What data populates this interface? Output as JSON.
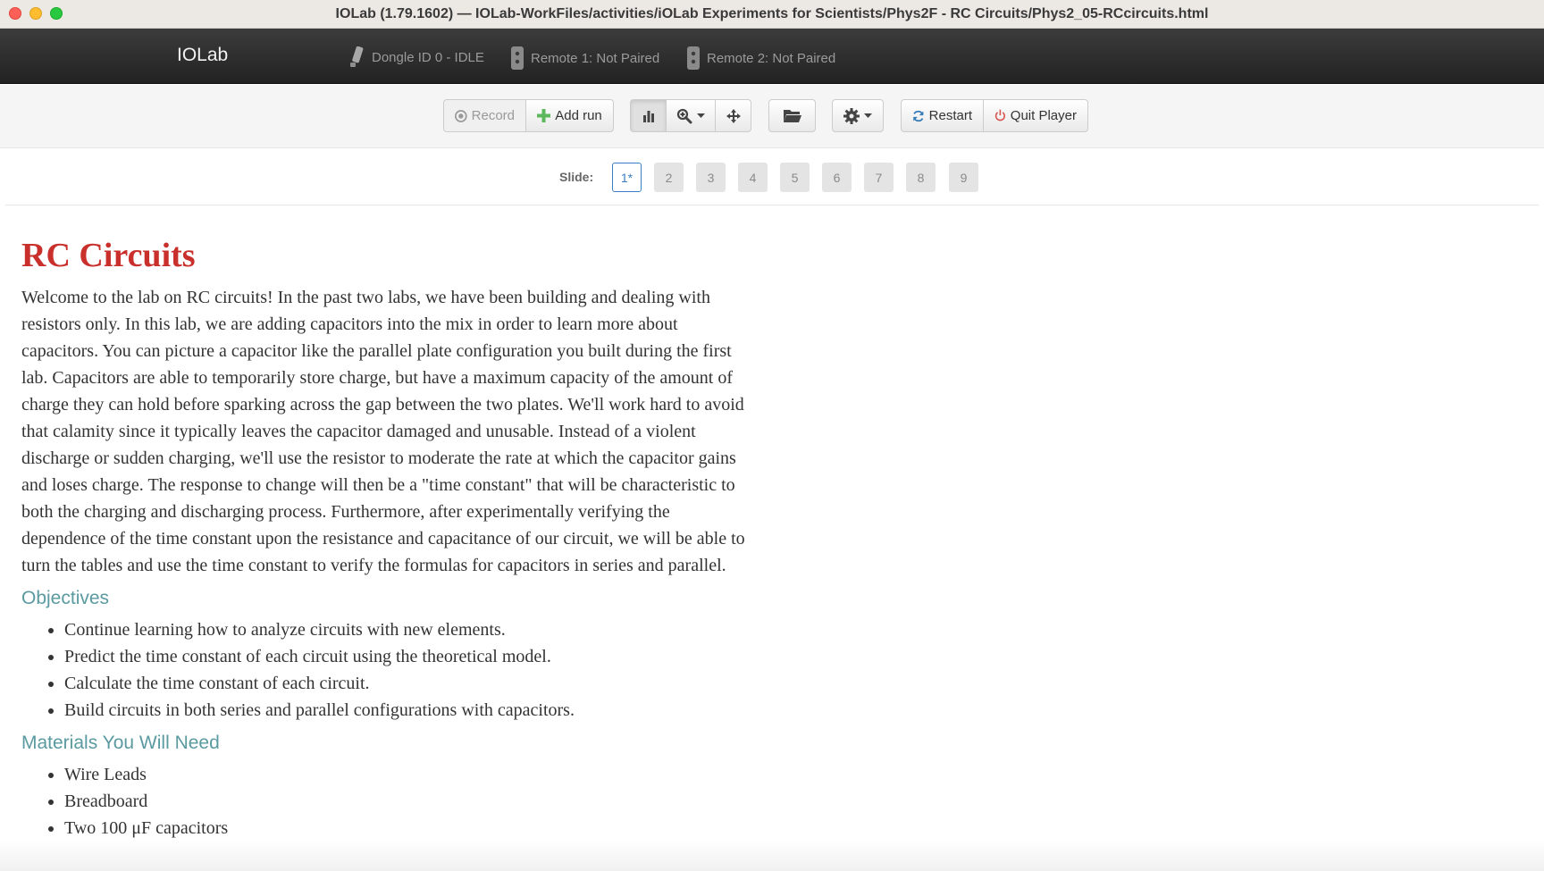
{
  "window": {
    "title": "IOLab (1.79.1602) — IOLab-WorkFiles/activities/iOLab Experiments for Scientists/Phys2F - RC Circuits/Phys2_05-RCcircuits.html"
  },
  "navbar": {
    "brand": "IOLab",
    "dongle": "Dongle ID 0 - IDLE",
    "remote1": "Remote 1: Not Paired",
    "remote2": "Remote 2: Not Paired"
  },
  "toolbar": {
    "record": "Record",
    "add_run": "Add run",
    "restart": "Restart",
    "quit": "Quit Player"
  },
  "slides": {
    "label": "Slide:",
    "items": [
      "1*",
      "2",
      "3",
      "4",
      "5",
      "6",
      "7",
      "8",
      "9"
    ]
  },
  "content": {
    "title": "RC Circuits",
    "intro": "Welcome to the lab on RC circuits! In the past two labs, we have been building and dealing with resistors only. In this lab, we are adding capacitors into the mix in order to learn more about capacitors. You can picture a capacitor like the parallel plate configuration you built during the first lab. Capacitors are able to temporarily store charge, but have a maximum capacity of the amount of charge they can hold before sparking across the gap between the two plates. We'll work hard to avoid that calamity since it typically leaves the capacitor damaged and unusable. Instead of a violent discharge or sudden charging, we'll use the resistor to moderate the rate at which the capacitor gains and loses charge. The response to change will then be a \"time constant\" that will be characteristic to both the charging and discharging process. Furthermore, after experimentally verifying the dependence of the time constant upon the resistance and capacitance of our circuit, we will be able to turn the tables and use the time constant to verify the formulas for capacitors in series and parallel.",
    "objectives_heading": "Objectives",
    "objectives": [
      "Continue learning how to analyze circuits with new elements.",
      "Predict the time constant of each circuit using the theoretical model.",
      "Calculate the time constant of each circuit.",
      "Build circuits in both series and parallel configurations with capacitors."
    ],
    "materials_heading": "Materials You Will Need",
    "materials": [
      "Wire Leads",
      "Breadboard",
      "Two 100 μF capacitors"
    ]
  },
  "colors": {
    "title_red": "#c9302c",
    "heading_teal": "#5a9aa0",
    "active_slide_blue": "#3a7fc1"
  }
}
